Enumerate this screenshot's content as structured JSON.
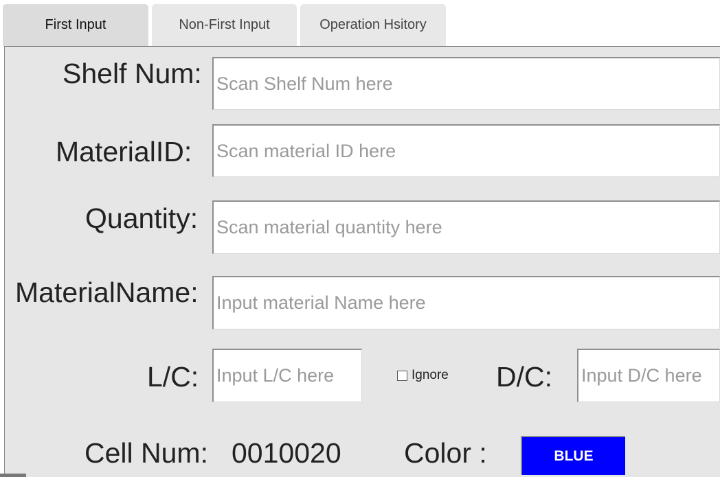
{
  "tabs": [
    {
      "label": "First Input",
      "active": true
    },
    {
      "label": "Non-First Input",
      "active": false
    },
    {
      "label": "Operation Hsitory",
      "active": false
    }
  ],
  "form": {
    "shelf_num": {
      "label": "Shelf Num:",
      "placeholder": "Scan Shelf Num here",
      "value": ""
    },
    "material_id": {
      "label": "MaterialID:",
      "placeholder": "Scan material ID here",
      "value": ""
    },
    "quantity": {
      "label": "Quantity:",
      "placeholder": "Scan material quantity here",
      "value": ""
    },
    "material_name": {
      "label": "MaterialName:",
      "placeholder": "Input material Name here",
      "value": ""
    },
    "lc": {
      "label": "L/C:",
      "placeholder": "Input L/C here",
      "value": ""
    },
    "ignore": {
      "label": "Ignore",
      "checked": false
    },
    "dc": {
      "label": "D/C:",
      "placeholder": "Input D/C here",
      "value": ""
    }
  },
  "cell": {
    "label": "Cell Num:",
    "value": "0010020"
  },
  "color": {
    "label": "Color :",
    "value": "BLUE",
    "hex": "#0000ff"
  }
}
